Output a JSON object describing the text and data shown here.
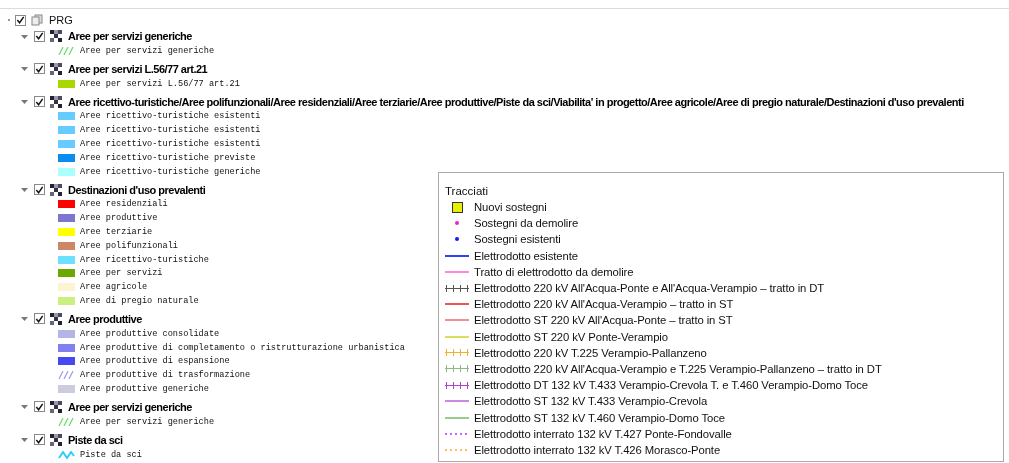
{
  "root": {
    "label": "PRG",
    "checked": true
  },
  "groups": [
    {
      "label": "Aree per servizi generiche",
      "checked": true,
      "expanded": true,
      "items": [
        {
          "label": "Aree per servizi generiche",
          "kind": "hatch",
          "color": "#66dd66"
        }
      ]
    },
    {
      "label": "Aree per servizi L.56/77 art.21",
      "checked": true,
      "expanded": true,
      "items": [
        {
          "label": "Aree per servizi L.56/77 art.21",
          "kind": "fill",
          "color": "#a8d800"
        }
      ]
    },
    {
      "label": "Aree ricettivo-turistiche/Aree polifunzionali/Aree residenziali/Aree terziarie/Aree produttive/Piste da sci/Viabilita' in progetto/Aree agricole/Aree di pregio naturale/Destinazioni d'uso prevalenti",
      "checked": true,
      "expanded": true,
      "items": [
        {
          "label": "Aree ricettivo-turistiche esistenti",
          "kind": "fill",
          "color": "#66ccff"
        },
        {
          "label": "Aree ricettivo-turistiche esistenti",
          "kind": "fill",
          "color": "#66ccff"
        },
        {
          "label": "Aree ricettivo-turistiche esistenti",
          "kind": "fill",
          "color": "#66ccff"
        },
        {
          "label": "Aree ricettivo-turistiche previste",
          "kind": "fill",
          "color": "#0a8cf0"
        },
        {
          "label": "Aree ricettivo-turistiche generiche",
          "kind": "fill",
          "color": "#aaffff"
        }
      ]
    },
    {
      "label": "Destinazioni d'uso prevalenti",
      "checked": true,
      "expanded": true,
      "items": [
        {
          "label": "Aree residenziali",
          "kind": "fill",
          "color": "#ff0000"
        },
        {
          "label": "Aree produttive",
          "kind": "fill",
          "color": "#7b76d0"
        },
        {
          "label": "Aree terziarie",
          "kind": "fill",
          "color": "#ffff00"
        },
        {
          "label": "Aree polifunzionali",
          "kind": "fill",
          "color": "#cc8866"
        },
        {
          "label": "Aree ricettivo-turistiche",
          "kind": "fill",
          "color": "#6ee0ff"
        },
        {
          "label": "Aree per servizi",
          "kind": "fill",
          "color": "#6aa800"
        },
        {
          "label": "Aree agricole",
          "kind": "fill",
          "color": "#faf5d0"
        },
        {
          "label": "Aree di pregio naturale",
          "kind": "fill",
          "color": "#ccf080"
        }
      ]
    },
    {
      "label": "Aree produttive",
      "checked": true,
      "expanded": true,
      "items": [
        {
          "label": "Aree produttive consolidate",
          "kind": "fill",
          "color": "#b4b4e6"
        },
        {
          "label": "Aree produttive di completamento o ristrutturazione urbanistica",
          "kind": "fill",
          "color": "#8080f0"
        },
        {
          "label": "Aree produttive di espansione",
          "kind": "fill",
          "color": "#4848f0"
        },
        {
          "label": "Aree produttive di trasformazione",
          "kind": "hatch",
          "color": "#9999ee"
        },
        {
          "label": "Aree produttive generiche",
          "kind": "fill",
          "color": "#cccce0"
        }
      ]
    },
    {
      "label": "Aree per servizi generiche",
      "checked": true,
      "expanded": true,
      "items": [
        {
          "label": "Aree per servizi generiche",
          "kind": "hatch",
          "color": "#66dd66"
        }
      ]
    },
    {
      "label": "Piste da sci",
      "checked": true,
      "expanded": true,
      "items": [
        {
          "label": "Piste da sci",
          "kind": "wave",
          "color": "#33ccff"
        }
      ]
    }
  ],
  "legend": {
    "title": "Tracciati",
    "entries": [
      {
        "label": "Nuovi sostegni",
        "kind": "square",
        "color": "#e6f000"
      },
      {
        "label": "Sostegni da demolire",
        "kind": "dot",
        "color": "#ee22cc"
      },
      {
        "label": "Sostegni esistenti",
        "kind": "dot",
        "color": "#1a1aee"
      },
      {
        "label": "Elettrodotto esistente",
        "kind": "line",
        "color": "#3344ee"
      },
      {
        "label": "Tratto di elettrodotto da demolire",
        "kind": "line",
        "color": "#ff88dd"
      },
      {
        "label": "Elettrodotto 220 kV All'Acqua-Ponte e All'Acqua-Verampio – tratto in DT",
        "kind": "cross",
        "color": "#555555"
      },
      {
        "label": "Elettrodotto 220 kV All'Acqua-Verampio – tratto in ST",
        "kind": "line",
        "color": "#ee5555"
      },
      {
        "label": "Elettrodotto ST 220 kV All'Acqua-Ponte – tratto in ST",
        "kind": "line",
        "color": "#f09090"
      },
      {
        "label": "Elettrodotto ST 220 kV Ponte-Verampio",
        "kind": "line",
        "color": "#d8e060"
      },
      {
        "label": "Elettrodotto 220 kV T.225 Verampio-Pallanzeno",
        "kind": "cross",
        "color": "#f0b030"
      },
      {
        "label": "Elettrodotto 220 kV All'Acqua-Verampio e T.225 Verampio-Pallanzeno – tratto in DT",
        "kind": "cross",
        "color": "#88bb88"
      },
      {
        "label": "Elettrodotto DT 132 kV T.433 Verampio-Crevola T. e T.460 Verampio-Domo Toce",
        "kind": "cross",
        "color": "#aa44cc"
      },
      {
        "label": "Elettrodotto ST 132 kV T.433 Verampio-Crevola",
        "kind": "line",
        "color": "#cc88dd"
      },
      {
        "label": "Elettrodotto ST 132 kV T.460 Verampio-Domo Toce",
        "kind": "line",
        "color": "#99cc88"
      },
      {
        "label": "Elettrodotto interrato 132 kV T.427 Ponte-Fondovalle",
        "kind": "dashed",
        "color": "#cc66ff"
      },
      {
        "label": "Elettrodotto interrato 132 kV T.426  Morasco-Ponte",
        "kind": "dashed",
        "color": "#ffbb66"
      }
    ]
  }
}
